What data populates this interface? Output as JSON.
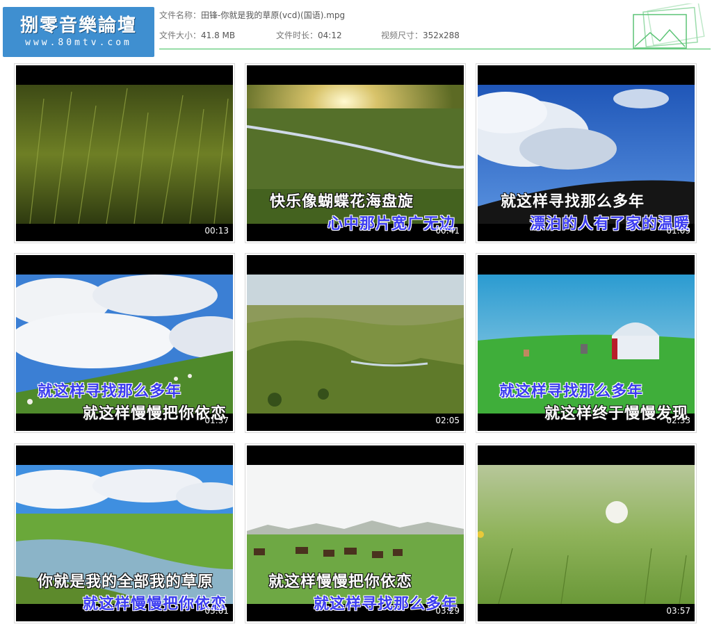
{
  "logo": {
    "title": "捌零音樂論壇",
    "url": "www.80mtv.com"
  },
  "file": {
    "name_label": "文件名称：",
    "name": "田锋-你就是我的草原(vcd)(国语).mpg",
    "size_label": "文件大小：",
    "size": "41.8 MB",
    "duration_label": "文件时长：",
    "duration": "04:12",
    "dims_label": "视频尺寸：",
    "dims": "352x288"
  },
  "thumbnails": [
    {
      "time": "00:13",
      "line1": "",
      "line2": ""
    },
    {
      "time": "00:41",
      "line1": "快乐像蝴蝶花海盘旋",
      "line2": "心中那片宽广无边"
    },
    {
      "time": "01:09",
      "line1": "就这样寻找那么多年",
      "line2": "漂泊的人有了家的温暖"
    },
    {
      "time": "01:37",
      "line1": "就这样寻找那么多年",
      "line2": "就这样慢慢把你依恋"
    },
    {
      "time": "02:05",
      "line1": "",
      "line2": ""
    },
    {
      "time": "02:33",
      "line1": "就这样寻找那么多年",
      "line2": "就这样终于慢慢发现"
    },
    {
      "time": "03:01",
      "line1": "你就是我的全部我的草原",
      "line2": "就这样慢慢把你依恋"
    },
    {
      "time": "03:29",
      "line1": "就这样慢慢把你依恋",
      "line2": "就这样寻找那么多年"
    },
    {
      "time": "03:57",
      "line1": "",
      "line2": ""
    }
  ]
}
